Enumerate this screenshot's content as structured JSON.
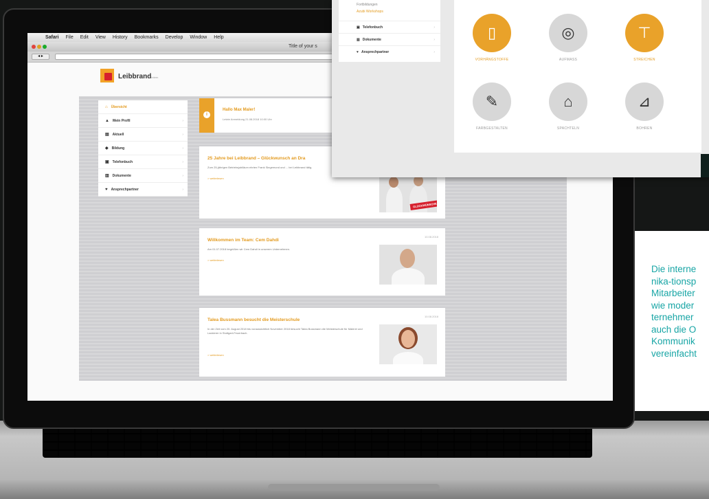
{
  "menubar": {
    "apple": "",
    "items": [
      "Safari",
      "File",
      "Edit",
      "View",
      "History",
      "Bookmarks",
      "Develop",
      "Window",
      "Help"
    ]
  },
  "browser": {
    "window_title": "Title of your s"
  },
  "site": {
    "logo_text": "Leibbrand",
    "logo_suffix": "intern"
  },
  "sidebar": {
    "items": [
      {
        "label": "Übersicht",
        "icon": "home-icon",
        "glyph": "⌂",
        "active": true
      },
      {
        "label": "Mein Profil",
        "icon": "user-icon",
        "glyph": "▲"
      },
      {
        "label": "Aktuell",
        "icon": "news-icon",
        "glyph": "▤"
      },
      {
        "label": "Bildung",
        "icon": "graduation-icon",
        "glyph": "◆"
      },
      {
        "label": "Telefonbuch",
        "icon": "phonebook-icon",
        "glyph": "▣"
      },
      {
        "label": "Dokumente",
        "icon": "documents-icon",
        "glyph": "▥"
      },
      {
        "label": "Ansprechpartner",
        "icon": "contact-icon",
        "glyph": "♥"
      }
    ]
  },
  "notice": {
    "title": "Hallo Max Maler!",
    "text": "Letzte Anmeldung 21.08.2018 10:00 Uhr",
    "icon": "info-icon",
    "glyph": "i"
  },
  "news": [
    {
      "title": "25 Jahre bei Leibbrand – Glückwunsch an Dra",
      "text": "Zum 25-jährigen Betriebsjubiläum ehrten Frank Siegemund und ... bei Leibbrand tätig.",
      "more": "> weiterlesen",
      "date": "",
      "badge": "GLÜCKWÜNSCHE"
    },
    {
      "title": "Willkommen im Team: Cem Dahdi",
      "text": "Am 01.07.2018 begrüßen wir Cem Dahdi in unserem Unternehmen.",
      "more": "> weiterlesen",
      "date": "10.08.2018",
      "badge": ""
    },
    {
      "title": "Talea Bussmann besucht die Meisterschule",
      "text": "In der Zeit vom 20. August 2018 bis voraussichtlich November 2018 besucht Talea Bussmann die Meisterschule für Malerei und Lackierer in Stuttgart-Feuerbach.",
      "more": "> weiterlesen",
      "date": "10.08.2018",
      "badge": ""
    }
  ],
  "overlay": {
    "top_items": [
      "Fortbildungen",
      "Azubi Workshops"
    ],
    "nav": [
      {
        "label": "Telefonbuch",
        "icon": "phonebook-icon",
        "glyph": "▣"
      },
      {
        "label": "Dokumente",
        "icon": "documents-icon",
        "glyph": "▥"
      },
      {
        "label": "Ansprechpartner",
        "icon": "contact-icon",
        "glyph": "♥"
      }
    ],
    "tiles": [
      {
        "label": "VORHÄNGSTOFFE",
        "icon": "curtain-icon",
        "glyph": "▯",
        "active": true
      },
      {
        "label": "AUFMASS",
        "icon": "tape-measure-icon",
        "glyph": "◎",
        "active": false
      },
      {
        "label": "STREICHEN",
        "icon": "paint-roller-icon",
        "glyph": "⊤",
        "active": true
      },
      {
        "label": "FARBGESTALTEN",
        "icon": "palette-icon",
        "glyph": "✎",
        "active": false
      },
      {
        "label": "SPACHTELN",
        "icon": "spatula-icon",
        "glyph": "⌂",
        "active": false
      },
      {
        "label": "BOHREN",
        "icon": "drill-icon",
        "glyph": "⊿",
        "active": false
      }
    ]
  },
  "caption": {
    "lines": [
      "Die interne",
      "nika-tionsp",
      "Mitarbeiter",
      "wie moder",
      "ternehmer",
      "auch die O",
      "Kommunik",
      "vereinfacht"
    ]
  },
  "colors": {
    "accent": "#e9a22a",
    "brand_red": "#d6202d",
    "caption": "#17a5a5"
  }
}
